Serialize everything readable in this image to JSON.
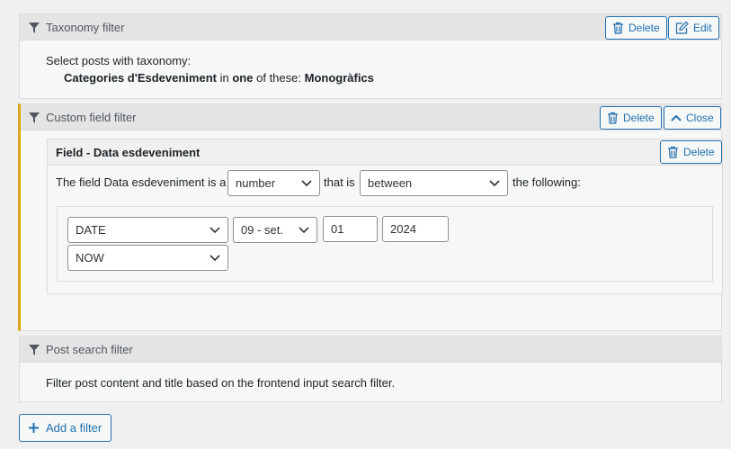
{
  "taxonomy_filter": {
    "title": "Taxonomy filter",
    "delete_label": "Delete",
    "edit_label": "Edit",
    "line1": "Select posts with taxonomy:",
    "taxonomy_name": "Categories d'Esdeveniment",
    "in_text": "in",
    "match": "one",
    "of_these": "of these:",
    "terms": "Monogràfics"
  },
  "custom_field_filter": {
    "title": "Custom field filter",
    "delete_label": "Delete",
    "close_label": "Close",
    "field": {
      "title": "Field - Data esdeveniment",
      "delete_label": "Delete",
      "sentence_start": "The field Data esdeveniment is a",
      "type_value": "number",
      "that_is": "that is",
      "operator_value": "between",
      "the_following": "the following:",
      "date_type_value": "DATE",
      "month_value": "09 - set.",
      "day_value": "01",
      "year_value": "2024",
      "second_value": "NOW"
    }
  },
  "post_search_filter": {
    "title": "Post search filter",
    "description": "Filter post content and title based on the frontend input search filter."
  },
  "add_filter_label": "Add a filter",
  "colors": {
    "accent": "#2271b1",
    "active_border": "#dba617"
  }
}
